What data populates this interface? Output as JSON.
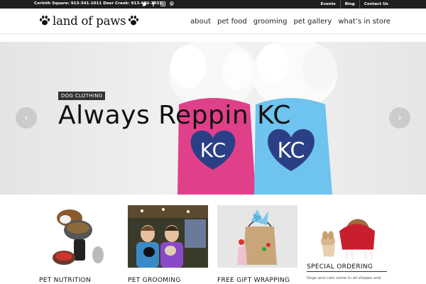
{
  "topbar": {
    "contact": "Corinth Square: 913-341-1011 Deer Creek: 913-402-1033",
    "social_icons": [
      "twitter-icon",
      "facebook-icon",
      "instagram-icon",
      "pinterest-icon"
    ],
    "links": [
      "Events",
      "Blog",
      "Contact Us"
    ]
  },
  "header": {
    "logo_text": "land of paws",
    "nav": [
      "about",
      "pet food",
      "grooming",
      "pet gallery",
      "what’s in store"
    ]
  },
  "hero": {
    "tag": "DOG CLOTHING",
    "headline": "Always Reppin KC",
    "shirt_text_left": "KC",
    "shirt_text_right": "KC",
    "prev_label": "‹",
    "next_label": "›"
  },
  "features": [
    {
      "label": "PET NUTRITION"
    },
    {
      "label": "PET GROOMING"
    },
    {
      "label": "FREE GIFT WRAPPING"
    },
    {
      "label": "SPECIAL ORDERING",
      "desc": "Dogs and cats come in all shapes and"
    }
  ],
  "colors": {
    "topbar_bg": "#1f1f1f",
    "pink": "#e0408a",
    "blue": "#6ec3ef",
    "heart": "#2b3f86"
  }
}
